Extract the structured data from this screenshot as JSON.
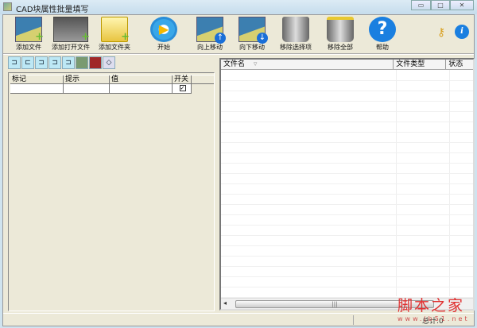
{
  "window": {
    "title": "CAD块属性批量填写",
    "minimize": "▭",
    "maximize": "□",
    "close": "✕"
  },
  "toolbar": [
    {
      "label": "添加文件",
      "icon": "add-file-icon"
    },
    {
      "label": "添加打开文件",
      "icon": "add-open-file-icon"
    },
    {
      "label": "添加文件夹",
      "icon": "add-folder-icon"
    },
    {
      "label": "开始",
      "icon": "play-icon"
    },
    {
      "label": "向上移动",
      "icon": "move-up-icon"
    },
    {
      "label": "向下移动",
      "icon": "move-down-icon"
    },
    {
      "label": "移除选择项",
      "icon": "remove-selected-icon"
    },
    {
      "label": "移除全部",
      "icon": "remove-all-icon"
    },
    {
      "label": "帮助",
      "icon": "help-icon"
    }
  ],
  "attr_grid": {
    "columns": [
      "标记",
      "提示",
      "值",
      "开关"
    ],
    "rows": [
      {
        "tag": "",
        "prompt": "",
        "value": "",
        "switch": true
      }
    ]
  },
  "file_list": {
    "columns": [
      "文件名",
      "文件类型",
      "状态"
    ],
    "sort_indicator": "▿",
    "rows": []
  },
  "status": {
    "text": "总计:0"
  },
  "watermark": {
    "text": "脚本之家",
    "url": "www.jb51.net"
  }
}
